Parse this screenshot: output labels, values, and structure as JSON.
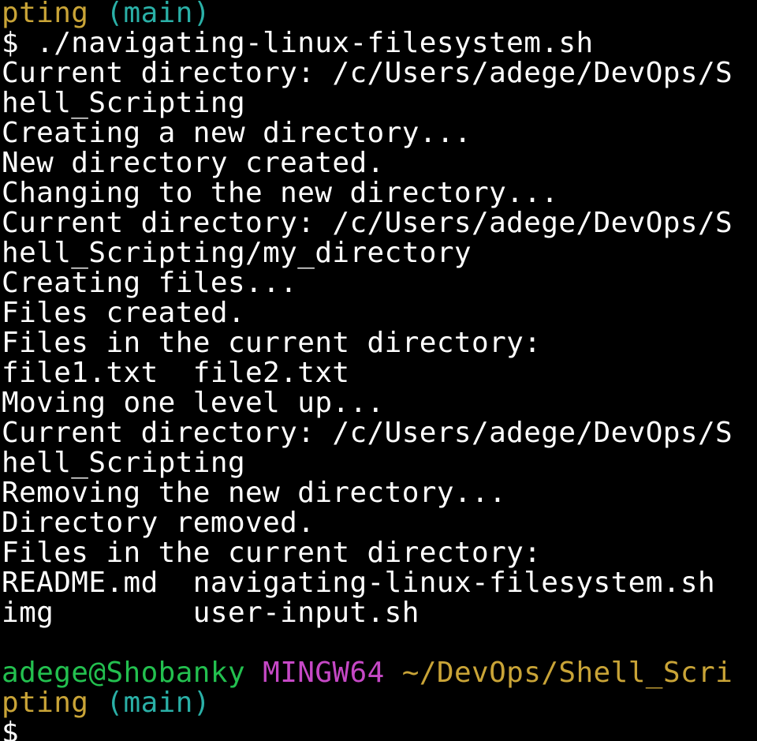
{
  "colors": {
    "background": "#000000",
    "text": "#ffffff",
    "user_host": "#23c04f",
    "shell_name": "#c648c6",
    "path": "#c9a437",
    "branch": "#2ab0a7"
  },
  "top_prompt": {
    "path_tail": "pting",
    "branch": "(main)"
  },
  "command_line": {
    "symbol": "$",
    "command": "./navigating-linux-filesystem.sh"
  },
  "output_lines": [
    "Current directory: /c/Users/adege/DevOps/S",
    "hell_Scripting",
    "Creating a new directory...",
    "New directory created.",
    "Changing to the new directory...",
    "Current directory: /c/Users/adege/DevOps/S",
    "hell_Scripting/my_directory",
    "Creating files...",
    "Files created.",
    "Files in the current directory:",
    "file1.txt  file2.txt",
    "Moving one level up...",
    "Current directory: /c/Users/adege/DevOps/S",
    "hell_Scripting",
    "Removing the new directory...",
    "Directory removed.",
    "Files in the current directory:",
    "README.md  navigating-linux-filesystem.sh",
    "img        user-input.sh"
  ],
  "bottom_prompt": {
    "user_host": "adege@Shobanky",
    "shell": "MINGW64",
    "path_head": "~/DevOps/Shell_Scri",
    "path_tail": "pting",
    "branch": "(main)",
    "symbol": "$"
  }
}
